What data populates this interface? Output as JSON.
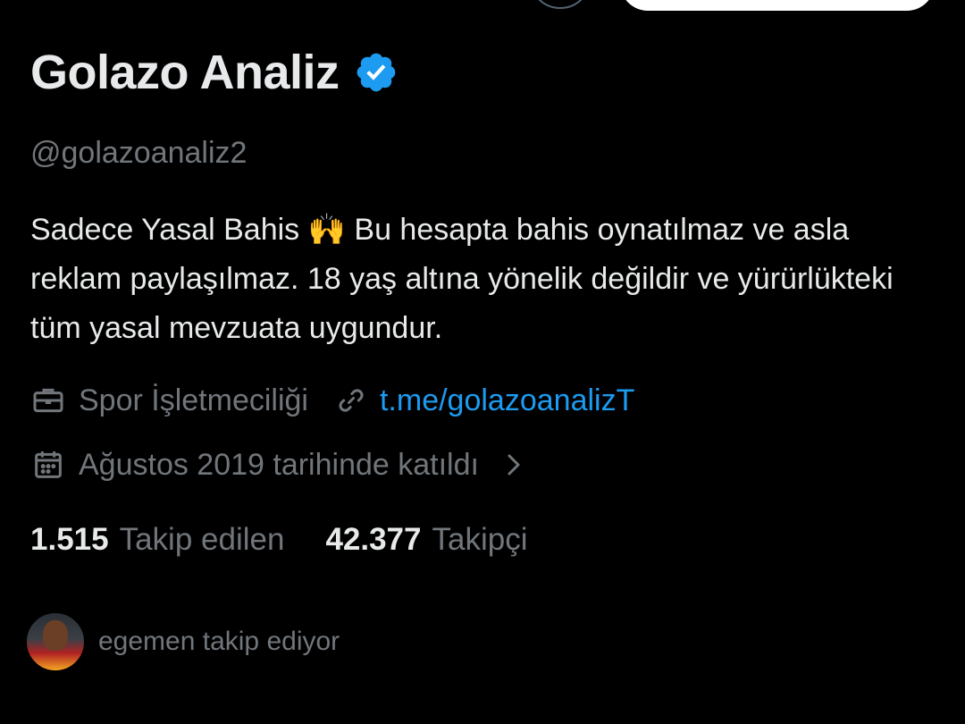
{
  "profile": {
    "display_name": "Golazo Analiz",
    "verified_icon": "verified-badge-icon",
    "handle": "@golazoanaliz2",
    "bio": "Sadece Yasal Bahis 🙌 Bu hesapta bahis oynatılmaz ve asla reklam paylaşılmaz. 18 yaş altına yönelik değildir ve yürürlükteki tüm yasal mevzuata uygundur.",
    "category": "Spor İşletmeciliği",
    "link": "t.me/golazoanalizT",
    "joined": "Ağustos 2019 tarihinde katıldı"
  },
  "stats": {
    "following_count": "1.515",
    "following_label": "Takip edilen",
    "followers_count": "42.377",
    "followers_label": "Takipçi"
  },
  "followed_by": {
    "text": "egemen takip ediyor"
  },
  "colors": {
    "background": "#000000",
    "text": "#e7e9ea",
    "secondary": "#71767b",
    "accent": "#1d9bf0"
  }
}
